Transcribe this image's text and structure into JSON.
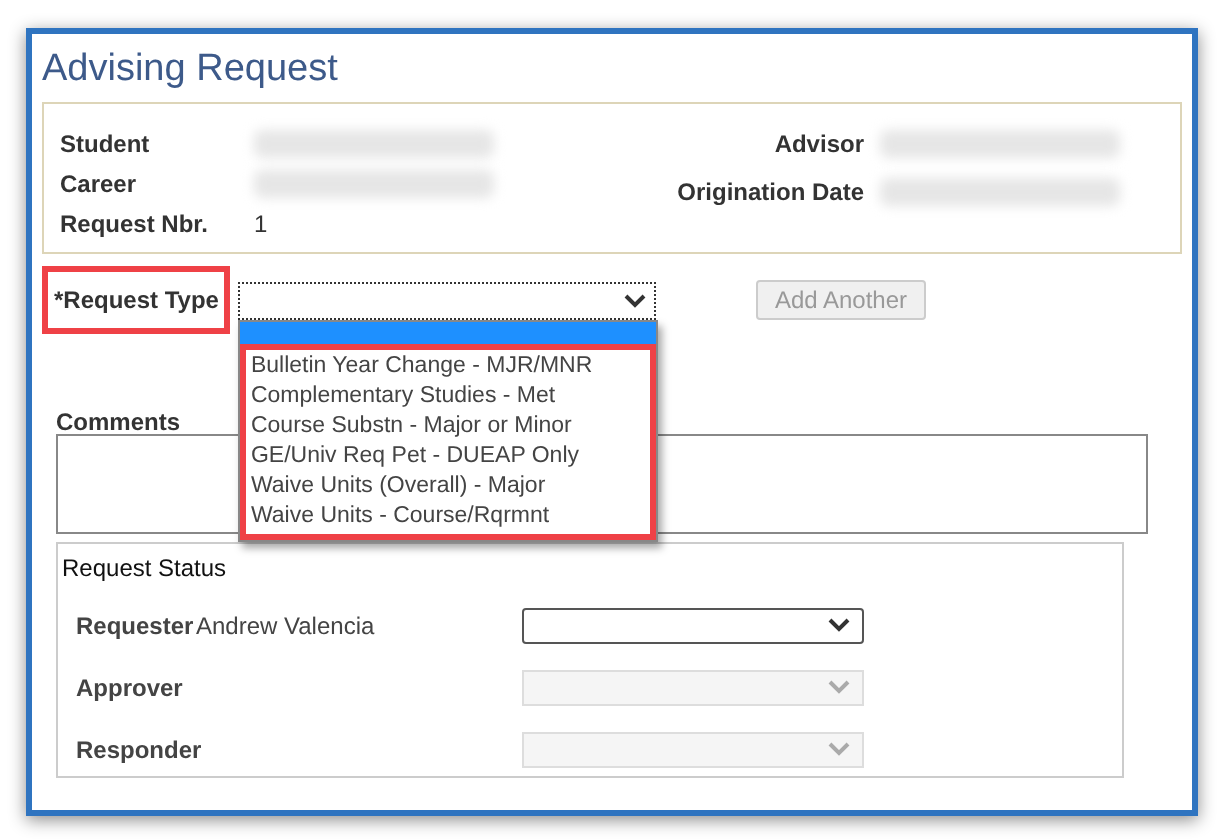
{
  "title": "Advising Request",
  "info": {
    "left": [
      {
        "label": "Student",
        "redacted": true
      },
      {
        "label": "Career",
        "redacted": true
      },
      {
        "label": "Request Nbr.",
        "value": "1"
      }
    ],
    "right": [
      {
        "label": "Advisor",
        "redacted": true
      },
      {
        "label": "Origination Date",
        "redacted": true
      }
    ]
  },
  "request_type": {
    "label": "*Request Type",
    "highlighted": true,
    "expanded": true,
    "options": [
      {
        "label": "Bulletin Year Change - MJR/MNR"
      },
      {
        "label": "Complementary Studies - Met"
      },
      {
        "label": "Course Substn - Major or Minor"
      },
      {
        "label": "GE/Univ Req Pet - DUEAP Only"
      },
      {
        "label": "Waive Units (Overall) - Major"
      },
      {
        "label": "Waive Units - Course/Rqrmnt"
      }
    ],
    "options_highlighted": true
  },
  "add_another": {
    "label": "Add Another",
    "disabled": true
  },
  "comments": {
    "label": "Comments"
  },
  "request_status": {
    "title": "Request Status",
    "rows": [
      {
        "label": "Requester",
        "name": "Andrew Valencia",
        "disabled": false
      },
      {
        "label": "Approver",
        "disabled": true
      },
      {
        "label": "Responder",
        "disabled": true
      }
    ]
  }
}
